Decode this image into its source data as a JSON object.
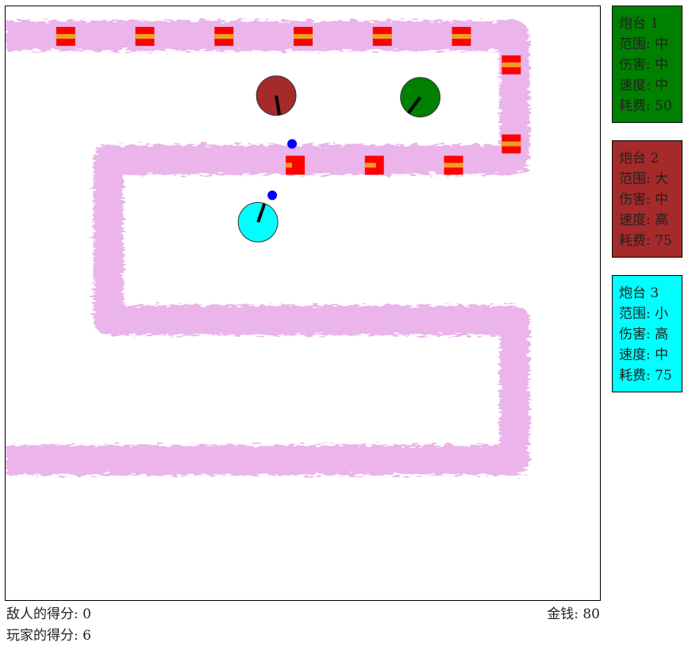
{
  "board": {
    "path_color": "#e8a8e8",
    "enemy_color": "#ff0000",
    "enemy_stripe_color": "#f0a020",
    "bullet_color": "#0000ff"
  },
  "towers": [
    {
      "card_title": "炮台 1",
      "range": "范围: 中",
      "damage": "伤害: 中",
      "speed": "速度: 中",
      "cost": "耗费: 50",
      "color": "#008000"
    },
    {
      "card_title": "炮台 2",
      "range": "范围: 大",
      "damage": "伤害: 中",
      "speed": "速度: 高",
      "cost": "耗费: 75",
      "color": "#a52a2a"
    },
    {
      "card_title": "炮台 3",
      "range": "范围: 小",
      "damage": "伤害: 高",
      "speed": "速度: 中",
      "cost": "耗费: 75",
      "color": "#00ffff"
    }
  ],
  "status": {
    "enemy_score": "敌人的得分: 0",
    "player_score": "玩家的得分: 6",
    "money": "金钱: 80"
  }
}
